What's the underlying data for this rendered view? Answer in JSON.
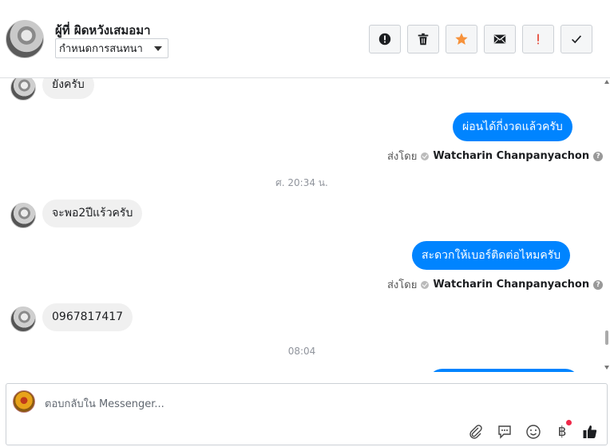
{
  "header": {
    "contact_name": "ผู้ที่ ผิดหวังเสมอมา",
    "assign_select": "กำหนดการสนทนา",
    "buttons": [
      {
        "name": "spam-button",
        "icon": "alert-circle-icon"
      },
      {
        "name": "delete-button",
        "icon": "trash-icon"
      },
      {
        "name": "star-button",
        "icon": "star-icon",
        "color": "#f7923b"
      },
      {
        "name": "mark-unread-button",
        "icon": "envelope-icon"
      },
      {
        "name": "follow-up-button",
        "icon": "exclamation-icon",
        "color": "#e74c3c"
      },
      {
        "name": "mark-done-button",
        "icon": "checkmark-icon"
      }
    ]
  },
  "messages": {
    "m1": "ยังครับ",
    "m2": "ผ่อนได้กี่งวดแล้วครับ",
    "m3": "จะพอ2ปีแร้วครับ",
    "m4": "สะดวกให้เบอร์ติดต่อไหมครับ",
    "m5": "0967817417",
    "sent_by_label": "ส่งโดย",
    "sender_name": "Watcharin Chanpanyachon",
    "time1": "ศ. 20:34 น.",
    "time2": "08:04"
  },
  "composer": {
    "placeholder": "ตอบกลับใน Messenger...",
    "currency_symbol": "฿"
  },
  "colors": {
    "outgoing_bubble": "#0084ff",
    "incoming_bubble": "#f0f0f0"
  }
}
